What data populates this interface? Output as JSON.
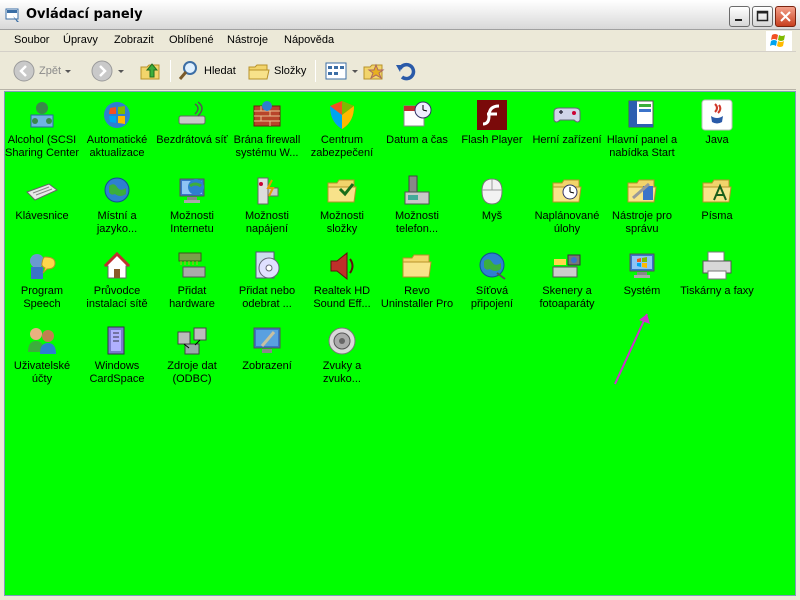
{
  "window": {
    "title": "Ovládací panely"
  },
  "menu": [
    {
      "label": "Soubor"
    },
    {
      "label": "Úpravy"
    },
    {
      "label": "Zobrazit"
    },
    {
      "label": "Oblíbené"
    },
    {
      "label": "Nástroje"
    },
    {
      "label": "Nápověda"
    }
  ],
  "toolbar": {
    "back_label": "Zpět",
    "search_label": "Hledat",
    "folders_label": "Složky"
  },
  "items": [
    {
      "label": "Alcohol (SCSI Sharing Center",
      "icon": "alcohol-icon"
    },
    {
      "label": "Automatické aktualizace",
      "icon": "windows-update-icon"
    },
    {
      "label": "Bezdrátová síť",
      "icon": "wireless-icon"
    },
    {
      "label": "Brána firewall systému W...",
      "icon": "firewall-icon"
    },
    {
      "label": "Centrum zabezpečení",
      "icon": "security-shield-icon"
    },
    {
      "label": "Datum a čas",
      "icon": "clock-icon"
    },
    {
      "label": "Flash Player",
      "icon": "flash-icon"
    },
    {
      "label": "Herní zařízení",
      "icon": "gamepad-icon"
    },
    {
      "label": "Hlavní panel a nabídka Start",
      "icon": "taskbar-icon"
    },
    {
      "label": "Java",
      "icon": "java-icon"
    },
    {
      "label": "Klávesnice",
      "icon": "keyboard-icon"
    },
    {
      "label": "Místní a jazyko...",
      "icon": "globe-icon"
    },
    {
      "label": "Možnosti Internetu",
      "icon": "internet-globe-icon"
    },
    {
      "label": "Možnosti napájení",
      "icon": "power-icon"
    },
    {
      "label": "Možnosti složky",
      "icon": "folder-options-icon"
    },
    {
      "label": "Možnosti telefon...",
      "icon": "phone-icon"
    },
    {
      "label": "Myš",
      "icon": "mouse-icon"
    },
    {
      "label": "Naplánované úlohy",
      "icon": "scheduled-tasks-icon"
    },
    {
      "label": "Nástroje pro správu",
      "icon": "admin-tools-icon"
    },
    {
      "label": "Písma",
      "icon": "fonts-folder-icon"
    },
    {
      "label": "Program Speech",
      "icon": "speech-icon"
    },
    {
      "label": "Průvodce instalací sítě",
      "icon": "network-home-icon"
    },
    {
      "label": "Přidat hardware",
      "icon": "hardware-icon"
    },
    {
      "label": "Přidat nebo odebrat ...",
      "icon": "add-remove-icon"
    },
    {
      "label": "Realtek HD Sound Eff...",
      "icon": "speaker-icon"
    },
    {
      "label": "Revo Uninstaller Pro",
      "icon": "folder-icon"
    },
    {
      "label": "Síťová připojení",
      "icon": "network-globe-icon"
    },
    {
      "label": "Skenery a fotoaparáty",
      "icon": "scanner-icon"
    },
    {
      "label": "Systém",
      "icon": "system-monitor-icon"
    },
    {
      "label": "Tiskárny a faxy",
      "icon": "printer-icon"
    },
    {
      "label": "Uživatelské účty",
      "icon": "users-icon"
    },
    {
      "label": "Windows CardSpace",
      "icon": "cardspace-icon"
    },
    {
      "label": "Zdroje dat (ODBC)",
      "icon": "odbc-icon"
    },
    {
      "label": "Zobrazení",
      "icon": "display-icon"
    },
    {
      "label": "Zvuky a zvuko...",
      "icon": "sound-icon"
    }
  ],
  "colors": {
    "background": "#00ff00",
    "annotation_arrow": "#cc33cc"
  }
}
